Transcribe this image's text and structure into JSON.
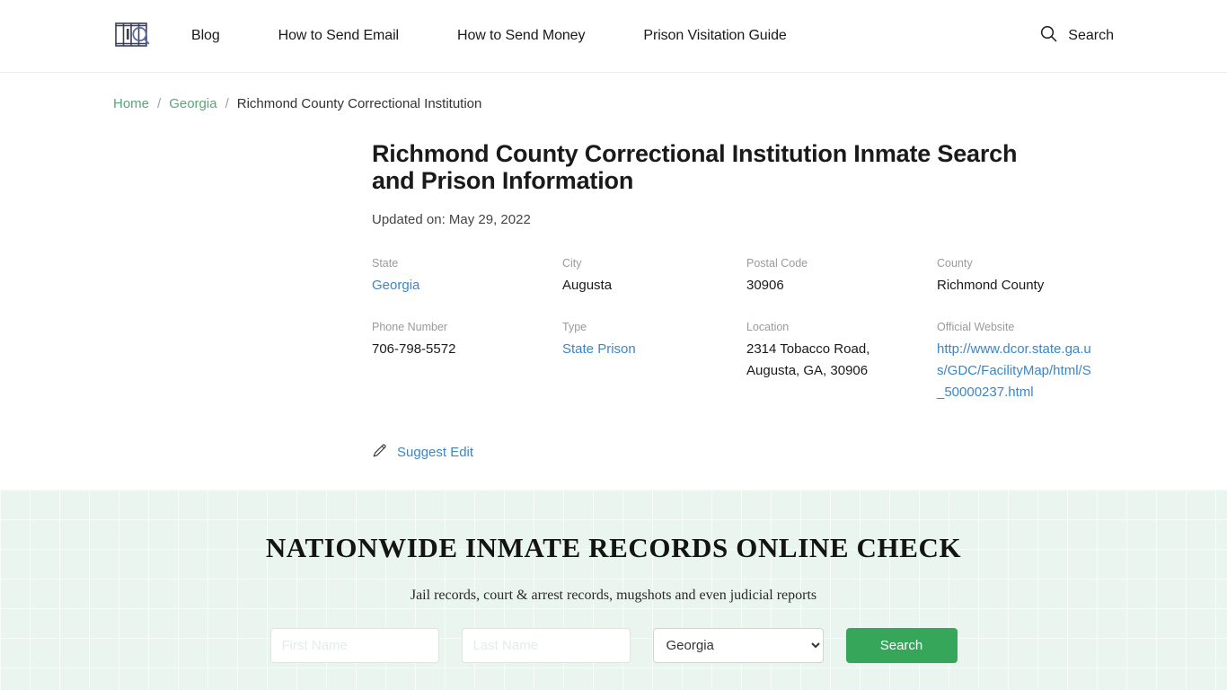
{
  "header": {
    "logo_icon": "prison-bars-search-logo",
    "nav": [
      {
        "label": "Blog"
      },
      {
        "label": "How to Send Email"
      },
      {
        "label": "How to Send Money"
      },
      {
        "label": "Prison Visitation Guide"
      }
    ],
    "search": {
      "icon": "search-icon",
      "label": "Search"
    }
  },
  "breadcrumb": {
    "home": "Home",
    "state": "Georgia",
    "current": "Richmond County Correctional Institution",
    "separator": "/"
  },
  "article": {
    "title": "Richmond County Correctional Institution Inmate Search and Prison Information",
    "updated": "Updated on: May 29, 2022",
    "info": [
      {
        "label": "State",
        "value": "Georgia",
        "link": true
      },
      {
        "label": "City",
        "value": "Augusta",
        "link": false
      },
      {
        "label": "Postal Code",
        "value": "30906",
        "link": false
      },
      {
        "label": "County",
        "value": "Richmond County",
        "link": false
      },
      {
        "label": "Phone Number",
        "value": "706-798-5572",
        "link": false
      },
      {
        "label": "Type",
        "value": "State Prison",
        "link": true
      },
      {
        "label": "Location",
        "value": "2314 Tobacco Road, Augusta, GA, 30906",
        "link": false
      },
      {
        "label": "Official Website",
        "value": "http://www.dcor.state.ga.us/GDC/FacilityMap/html/S_50000237.html",
        "link": true
      }
    ],
    "suggest_edit": {
      "icon": "pencil-icon",
      "label": "Suggest Edit"
    }
  },
  "promo": {
    "title": "NATIONWIDE INMATE RECORDS ONLINE CHECK",
    "subtitle": "Jail records, court & arrest records, mugshots and even judicial reports",
    "first_name_placeholder": "First Name",
    "first_name_value": "",
    "last_name_placeholder": "Last Name",
    "last_name_value": "",
    "state_selected": "Georgia",
    "state_options": [
      "Georgia"
    ],
    "search_button": "Search"
  },
  "colors": {
    "brand_green": "#36a65b",
    "breadcrumb_link": "#5aa678",
    "info_link": "#3a86c8",
    "promo_bg": "#e9f5ee"
  }
}
